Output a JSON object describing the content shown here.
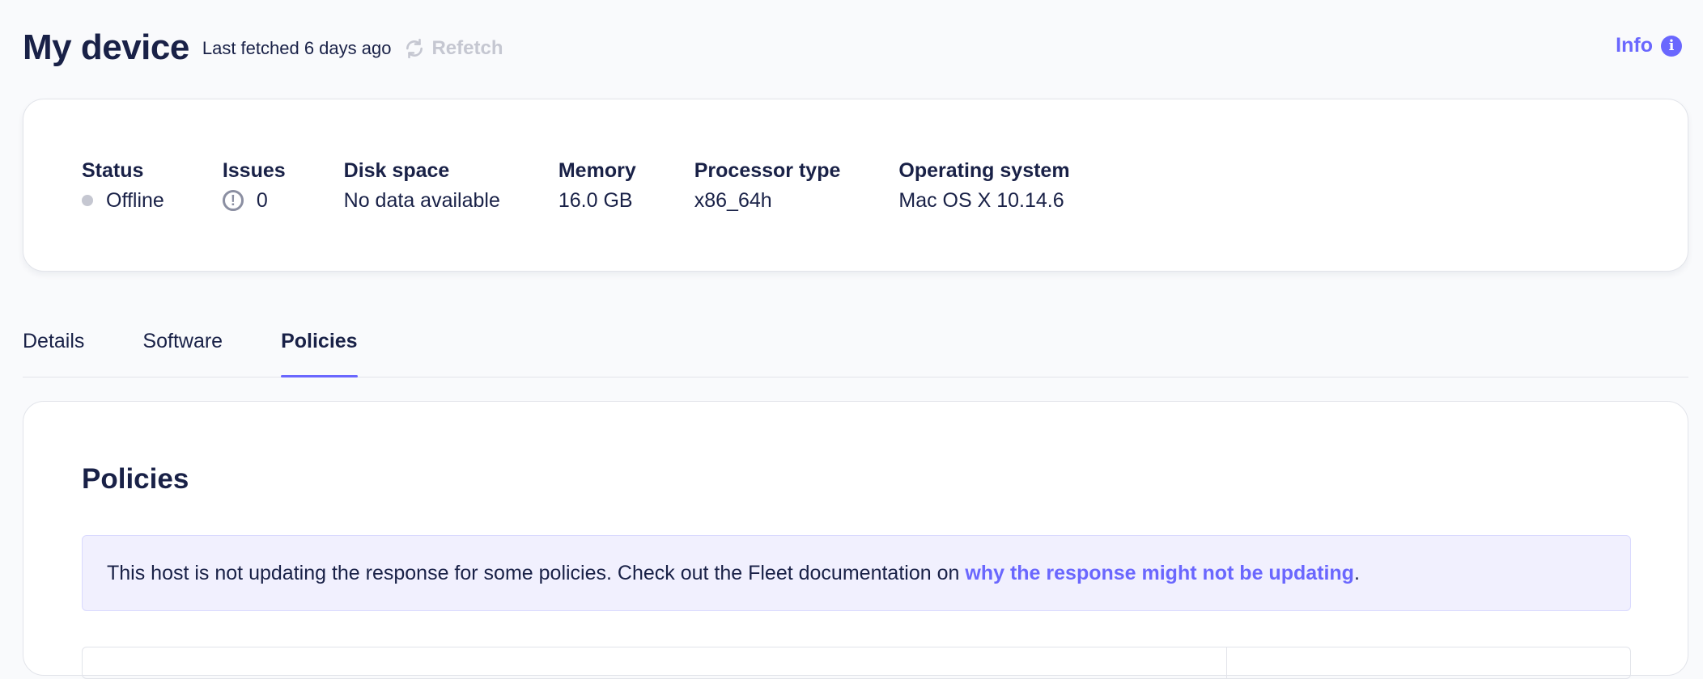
{
  "header": {
    "title": "My device",
    "last_fetched": "Last fetched 6 days ago",
    "refetch_label": "Refetch",
    "info_label": "Info",
    "info_glyph": "i"
  },
  "summary": {
    "status": {
      "label": "Status",
      "value": "Offline"
    },
    "issues": {
      "label": "Issues",
      "value": "0",
      "icon_glyph": "!"
    },
    "disk_space": {
      "label": "Disk space",
      "value": "No data available"
    },
    "memory": {
      "label": "Memory",
      "value": "16.0 GB"
    },
    "processor_type": {
      "label": "Processor type",
      "value": "x86_64h"
    },
    "operating_system": {
      "label": "Operating system",
      "value": "Mac OS X 10.14.6"
    }
  },
  "tabs": [
    {
      "label": "Details",
      "active": false
    },
    {
      "label": "Software",
      "active": false
    },
    {
      "label": "Policies",
      "active": true
    }
  ],
  "policies": {
    "title": "Policies",
    "banner_text": "This host is not updating the response for some policies. Check out the Fleet documentation on",
    "banner_link": "why the response might not be updating",
    "banner_end": "."
  },
  "colors": {
    "accent": "#6a67fe",
    "text": "#192147",
    "muted": "#c5c7d1",
    "banner_bg": "#f1f0fe"
  }
}
